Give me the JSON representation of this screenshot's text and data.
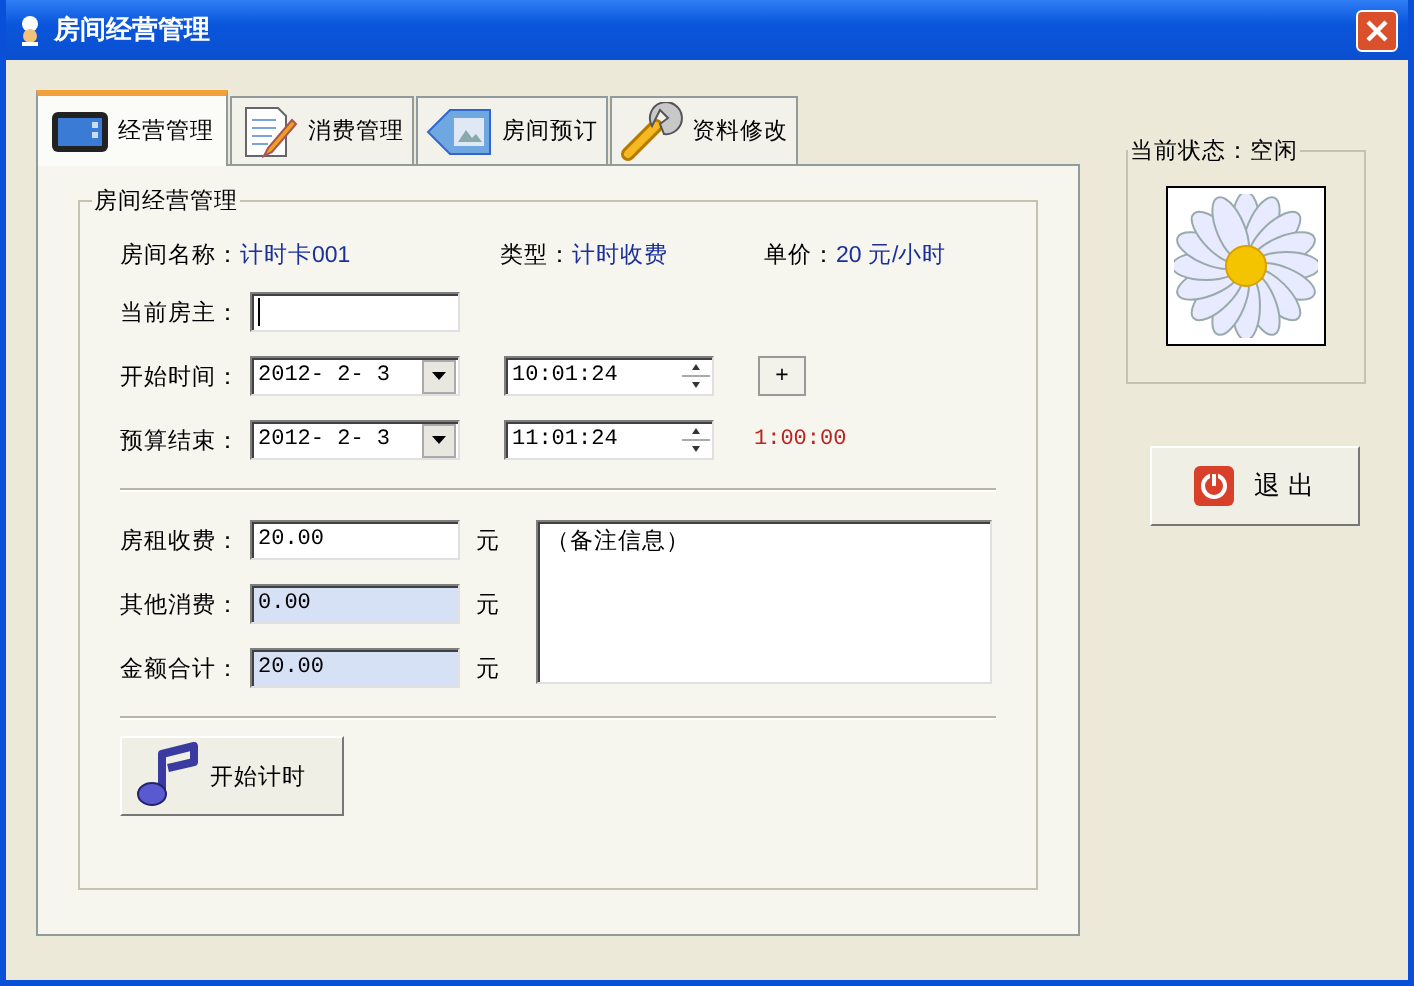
{
  "window": {
    "title": "房间经营管理"
  },
  "tabs": [
    {
      "label": "经营管理",
      "selected": true
    },
    {
      "label": "消费管理",
      "selected": false
    },
    {
      "label": "房间预订",
      "selected": false
    },
    {
      "label": "资料修改",
      "selected": false
    }
  ],
  "group": {
    "title": "房间经营管理",
    "info": [
      {
        "label": "房间名称：",
        "value": "计时卡001"
      },
      {
        "label": "类型：",
        "value": "计时收费"
      },
      {
        "label": "单价：",
        "value": "20 元/小时"
      }
    ],
    "owner": {
      "label": "当前房主："
    },
    "start": {
      "label": "开始时间：",
      "date": "2012- 2- 3",
      "time": "10:01:24",
      "button": "+"
    },
    "end": {
      "label": "预算结束：",
      "date": "2012- 2- 3",
      "time": "11:01:24",
      "duration": "1:00:00"
    },
    "money": [
      {
        "label": "房租收费：",
        "value": "20.00",
        "unit": "元",
        "readonly": false
      },
      {
        "label": "其他消费：",
        "value": "0.00",
        "unit": "元",
        "readonly": true
      },
      {
        "label": "金额合计：",
        "value": "20.00",
        "unit": "元",
        "readonly": true
      }
    ],
    "notes": "（备注信息）",
    "start_button": "开始计时"
  },
  "status": {
    "title": "当前状态：空闲"
  },
  "exit_button": "退 出"
}
